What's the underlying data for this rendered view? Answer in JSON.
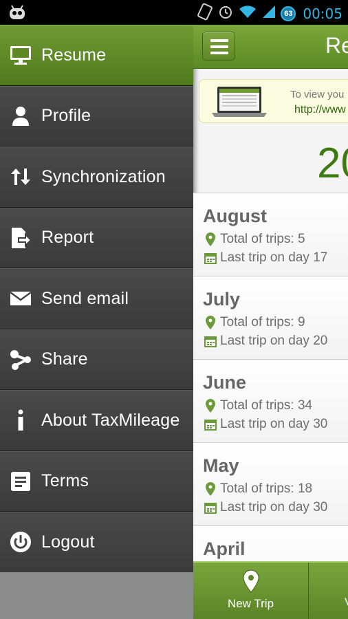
{
  "status_bar": {
    "time": "00:05",
    "battery": "63"
  },
  "drawer": {
    "items": [
      {
        "label": "Resume",
        "icon": "monitor-icon",
        "active": true
      },
      {
        "label": "Profile",
        "icon": "person-icon"
      },
      {
        "label": "Synchronization",
        "icon": "sync-arrows-icon"
      },
      {
        "label": "Report",
        "icon": "report-export-icon"
      },
      {
        "label": "Send email",
        "icon": "envelope-icon"
      },
      {
        "label": "Share",
        "icon": "share-icon"
      },
      {
        "label": "About TaxMileage",
        "icon": "info-icon"
      },
      {
        "label": "Terms",
        "icon": "terms-document-icon"
      },
      {
        "label": "Logout",
        "icon": "power-icon"
      }
    ]
  },
  "main": {
    "title": "Re",
    "banner": {
      "line1": "To view you",
      "line2": "http://www"
    },
    "year": "20",
    "months": [
      {
        "name": "August",
        "trips": "Total of trips: 5",
        "last": "Last trip on day 17"
      },
      {
        "name": "July",
        "trips": "Total of trips: 9",
        "last": "Last trip on day 20"
      },
      {
        "name": "June",
        "trips": "Total of trips: 34",
        "last": "Last trip on day 30"
      },
      {
        "name": "May",
        "trips": "Total of trips: 18",
        "last": "Last trip on day 30"
      },
      {
        "name": "April"
      }
    ],
    "tabs": [
      {
        "label": "New Trip",
        "icon": "map-pin-icon"
      },
      {
        "label": "V"
      }
    ]
  },
  "colors": {
    "accent_green": "#5c8a24",
    "active_menu": "#5e8a26",
    "status_time": "#33b5e5"
  }
}
